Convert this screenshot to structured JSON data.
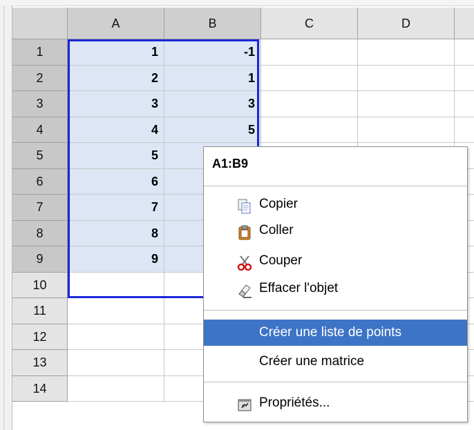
{
  "columns": [
    "A",
    "B",
    "C",
    "D"
  ],
  "rows": [
    {
      "num": "1",
      "a": "1",
      "b": "-1"
    },
    {
      "num": "2",
      "a": "2",
      "b": "1"
    },
    {
      "num": "3",
      "a": "3",
      "b": "3"
    },
    {
      "num": "4",
      "a": "4",
      "b": "5"
    },
    {
      "num": "5",
      "a": "5",
      "b": ""
    },
    {
      "num": "6",
      "a": "6",
      "b": ""
    },
    {
      "num": "7",
      "a": "7",
      "b": ""
    },
    {
      "num": "8",
      "a": "8",
      "b": ""
    },
    {
      "num": "9",
      "a": "9",
      "b": ""
    },
    {
      "num": "10",
      "a": "",
      "b": ""
    },
    {
      "num": "11",
      "a": "",
      "b": ""
    },
    {
      "num": "12",
      "a": "",
      "b": ""
    },
    {
      "num": "13",
      "a": "",
      "b": ""
    },
    {
      "num": "14",
      "a": "",
      "b": ""
    }
  ],
  "context_menu": {
    "title": "A1:B9",
    "items": [
      {
        "label": "Copier",
        "icon": "copy-icon"
      },
      {
        "label": "Coller",
        "icon": "paste-icon"
      },
      {
        "label": "Couper",
        "icon": "scissors-icon"
      },
      {
        "label": "Effacer l'objet",
        "icon": "eraser-icon"
      },
      {
        "label": "Créer une liste de points",
        "icon": ""
      },
      {
        "label": "Créer une matrice",
        "icon": ""
      },
      {
        "label": "Propriétés...",
        "icon": "properties-icon"
      }
    ]
  },
  "colors": {
    "selection_border": "#1a27d6",
    "selection_fill": "#dde6f5",
    "menu_highlight": "#3e74c6"
  }
}
